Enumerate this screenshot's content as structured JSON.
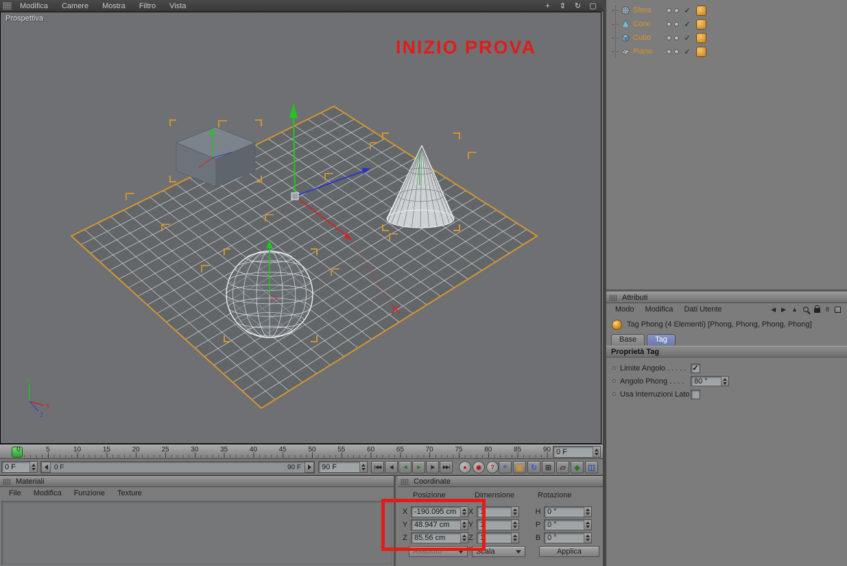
{
  "menubar": {
    "items": [
      "Modifica",
      "Camere",
      "Mostra",
      "Filtro",
      "Vista"
    ]
  },
  "view_controls": [
    {
      "name": "pan-view-icon",
      "glyph": "+"
    },
    {
      "name": "zoom-view-icon",
      "glyph": "⇕"
    },
    {
      "name": "rotate-view-icon",
      "glyph": "↻"
    },
    {
      "name": "maximize-view-icon",
      "glyph": "▢"
    }
  ],
  "viewport": {
    "label": "Prospettiva",
    "annotation": "INIZIO PROVA",
    "axis_gizmo_labels": {
      "x": "X",
      "y": "Y",
      "z": "Z"
    }
  },
  "object_manager": {
    "items": [
      {
        "name": "Sfera",
        "icon": "sphere-icon"
      },
      {
        "name": "Cono",
        "icon": "cone-icon"
      },
      {
        "name": "Cubo",
        "icon": "cube-icon"
      },
      {
        "name": "Piano",
        "icon": "plane-icon"
      }
    ]
  },
  "attributes": {
    "title": "Attributi",
    "menu": [
      "Modo",
      "Modifica",
      "Dati Utente"
    ],
    "toolbar_icons": [
      {
        "name": "back-icon",
        "glyph": "◀"
      },
      {
        "name": "forward-icon",
        "glyph": "▶"
      },
      {
        "name": "up-icon",
        "glyph": "▲"
      },
      {
        "name": "search-icon",
        "css": "search"
      },
      {
        "name": "lock-icon",
        "css": "lock"
      },
      {
        "name": "filter-8-icon",
        "glyph": "8"
      },
      {
        "name": "panel-menu-icon",
        "css": "panelbox"
      }
    ],
    "tag_title": "Tag Phong (4 Elementi) [Phong, Phong, Phong, Phong]",
    "tabs": [
      "Base",
      "Tag"
    ],
    "active_tab": "Tag",
    "section_title": "Proprietà Tag",
    "properties": [
      {
        "label": "Limite Angolo . . . . .",
        "type": "checkbox",
        "checked": true
      },
      {
        "label": "Angolo Phong . . . .",
        "type": "spin",
        "value": "80 °"
      },
      {
        "label": "Usa Interruzioni Lato",
        "type": "checkbox",
        "checked": false
      }
    ]
  },
  "timeline": {
    "ruler_labels": [
      "0",
      "5",
      "10",
      "15",
      "20",
      "25",
      "30",
      "35",
      "40",
      "45",
      "50",
      "55",
      "60",
      "65",
      "70",
      "75",
      "80",
      "85",
      "90"
    ],
    "current_frame_field": "0 F",
    "start_frame_field": "0 F",
    "end_frame_field": "90 F",
    "range_start": "0 F",
    "range_end": "90 F"
  },
  "transport_buttons": [
    {
      "name": "goto-start-button",
      "glyph": "|◀◀"
    },
    {
      "name": "prev-frame-button",
      "glyph": "◀|"
    },
    {
      "name": "play-reverse-button",
      "glyph": "◀",
      "color": "#1d7a1d"
    },
    {
      "name": "play-button",
      "glyph": "▶",
      "color": "#1d7a1d"
    },
    {
      "name": "next-frame-button",
      "glyph": "|▶"
    },
    {
      "name": "goto-end-button",
      "glyph": "▶▶|"
    }
  ],
  "record_buttons": [
    {
      "name": "record-keyframe-button",
      "glyph": "●"
    },
    {
      "name": "autokey-button",
      "glyph": "◉"
    },
    {
      "name": "record-help-button",
      "glyph": "?"
    }
  ],
  "key_toggles": [
    {
      "name": "position-key-toggle",
      "glyph": "+",
      "color": "#3b57c4"
    },
    {
      "name": "scale-key-toggle",
      "glyph": "▣",
      "color": "#d68f2e"
    },
    {
      "name": "rotation-key-toggle",
      "glyph": "↻",
      "color": "#3b57c4"
    },
    {
      "name": "parameter-key-toggle",
      "glyph": "⊞",
      "color": "#333333"
    },
    {
      "name": "pla-key-toggle",
      "glyph": "▱",
      "color": "#333333"
    },
    {
      "name": "ik-key-toggle",
      "glyph": "◈",
      "color": "#1d7a1d"
    },
    {
      "name": "layout-toggle",
      "glyph": "◫",
      "color": "#2b4ab0"
    }
  ],
  "materials_panel": {
    "title": "Materiali",
    "menu": [
      "File",
      "Modifica",
      "Funzione",
      "Texture"
    ]
  },
  "coordinates_panel": {
    "title": "Coordinate",
    "columns": [
      "Posizione",
      "Dimensione",
      "Rotazione"
    ],
    "rows": [
      {
        "pos_label": "X",
        "pos": "-190.095 cm",
        "dim_label": "X",
        "dim": "1",
        "rot_label": "H",
        "rot": "0 °"
      },
      {
        "pos_label": "Y",
        "pos": "48.947 cm",
        "dim_label": "Y",
        "dim": "1",
        "rot_label": "P",
        "rot": "0 °"
      },
      {
        "pos_label": "Z",
        "pos": "85.56 cm",
        "dim_label": "Z",
        "dim": "1",
        "rot_label": "B",
        "rot": "0 °"
      }
    ],
    "mode_dropdown": "Assoluto",
    "size_dropdown": "Scala",
    "apply_button": "Applica"
  },
  "colors": {
    "accent_orange": "#d6952f",
    "annotation_red": "#e41b17",
    "tab_blue": "#7282b8",
    "timeline_green": "#35c435",
    "axis_green": "#21c421",
    "axis_red": "#d42222",
    "axis_blue": "#2b32c8"
  }
}
